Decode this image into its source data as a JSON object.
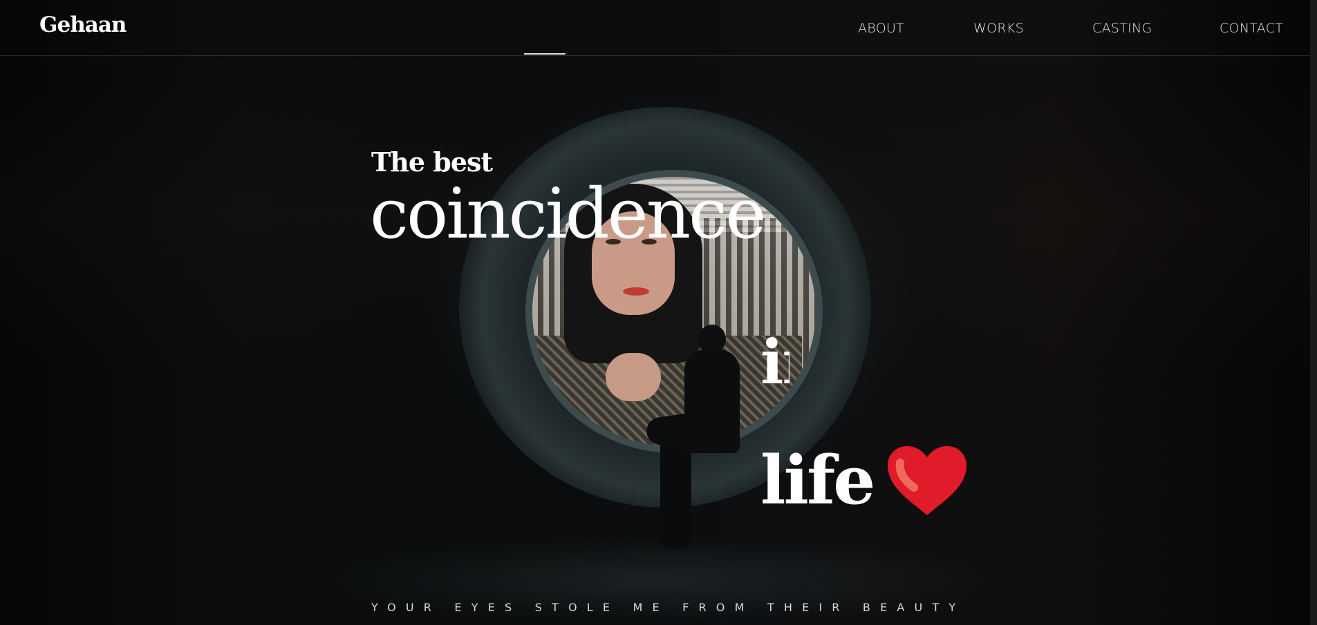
{
  "header": {
    "logo": "Gehaan",
    "nav": [
      {
        "label": "ABOUT"
      },
      {
        "label": "WORKS"
      },
      {
        "label": "CASTING"
      },
      {
        "label": "CONTACT"
      }
    ]
  },
  "hero": {
    "line1": "The best",
    "line2": "coincidence",
    "line3": "in",
    "line4": "life",
    "heart_icon": "red-heart-icon",
    "tagline": "YOUR EYES STOLE ME FROM THEIR BEAUTY"
  },
  "colors": {
    "background": "#030405",
    "text": "#ffffff",
    "heart": "#e01b2a",
    "heart_highlight": "#f06a5a"
  }
}
